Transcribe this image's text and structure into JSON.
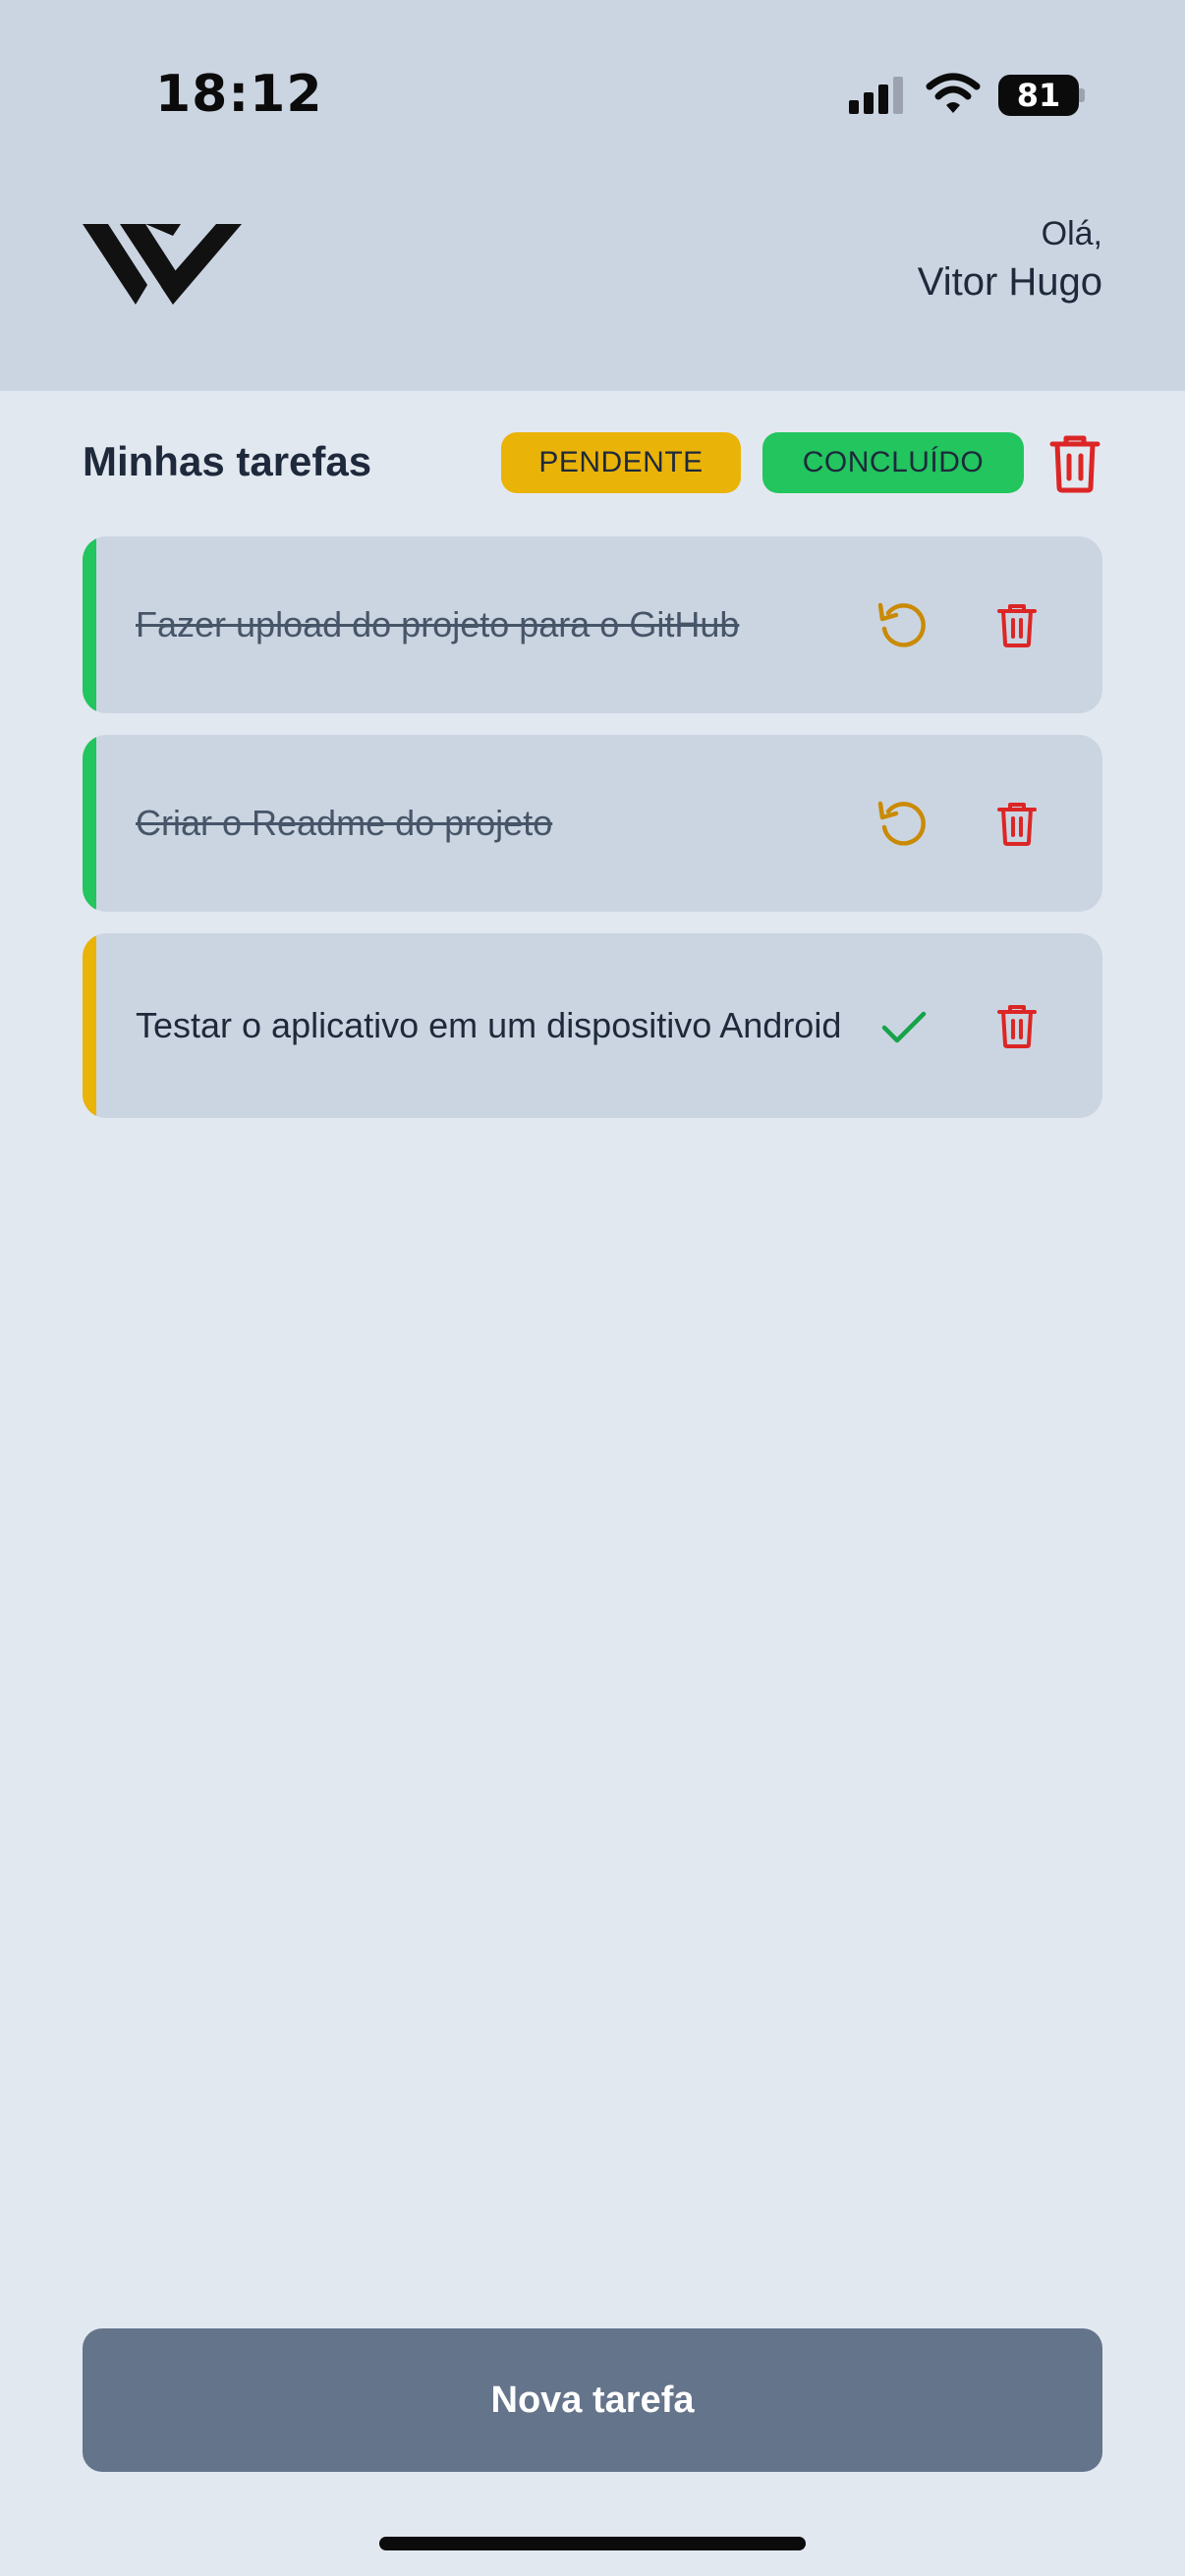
{
  "status_bar": {
    "time": "18:12",
    "battery": "81",
    "icons": [
      "cellular-signal-icon",
      "wifi-icon",
      "battery-icon"
    ]
  },
  "header": {
    "logo_icon": "vw-logo",
    "greeting": "Olá,",
    "user_name": "Vitor Hugo"
  },
  "toolbar": {
    "title": "Minhas tarefas",
    "filter_pending": "PENDENTE",
    "filter_done": "CONCLUÍDO",
    "clear_icon": "trash-icon"
  },
  "tasks": [
    {
      "text": "Fazer upload do projeto para o GitHub",
      "status": "done",
      "action_icon": "undo-icon"
    },
    {
      "text": "Criar o Readme do projeto",
      "status": "done",
      "action_icon": "undo-icon"
    },
    {
      "text": "Testar o aplicativo em um dispositivo Android",
      "status": "pending",
      "action_icon": "check-icon"
    }
  ],
  "footer": {
    "new_task_label": "Nova tarefa"
  },
  "colors": {
    "header_bg": "#cbd5e1",
    "page_bg": "#e2e8f0",
    "pending": "#eab308",
    "done": "#22c55e",
    "delete": "#dc2626",
    "undo": "#ca8a04",
    "check": "#16a34a",
    "button": "#64748b"
  }
}
